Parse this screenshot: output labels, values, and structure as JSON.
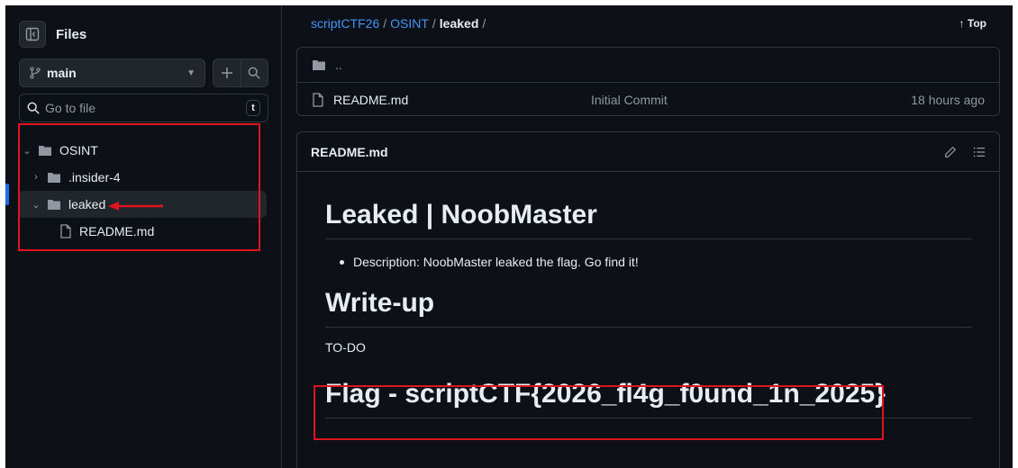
{
  "sidebar": {
    "title": "Files",
    "branch": "main",
    "search_placeholder": "Go to file",
    "search_shortcut": "t",
    "tree": [
      {
        "label": "OSINT",
        "type": "folder",
        "expanded": true,
        "depth": 0
      },
      {
        "label": ".insider-4",
        "type": "folder",
        "expanded": false,
        "depth": 1
      },
      {
        "label": "leaked",
        "type": "folder",
        "expanded": true,
        "depth": 1,
        "selected": true
      },
      {
        "label": "README.md",
        "type": "file",
        "depth": 2
      }
    ]
  },
  "breadcrumb": {
    "repo": "scriptCTF26",
    "folder": "OSINT",
    "current": "leaked",
    "separator": "/",
    "top_label": "Top"
  },
  "file_list": {
    "parent": "..",
    "rows": [
      {
        "name": "README.md",
        "message": "Initial Commit",
        "date": "18 hours ago"
      }
    ]
  },
  "readme": {
    "header": "README.md",
    "title": "Leaked | NoobMaster",
    "description": "Description: NoobMaster leaked the flag. Go find it!",
    "section": "Write-up",
    "todo": "TO-DO",
    "flag": "Flag - scriptCTF{2026_fl4g_f0und_1n_2025}"
  },
  "colors": {
    "link": "#4493f8",
    "highlight": "#e0141e",
    "selection_bar": "#1f6feb",
    "background": "#0d1117"
  },
  "icons": [
    "sidebar-toggle-icon",
    "git-branch-icon",
    "plus-icon",
    "search-icon",
    "folder-icon",
    "file-icon",
    "pencil-icon",
    "list-icon",
    "arrow-up-icon",
    "chevron-down-icon",
    "chevron-right-icon",
    "red-arrow-annotation"
  ]
}
